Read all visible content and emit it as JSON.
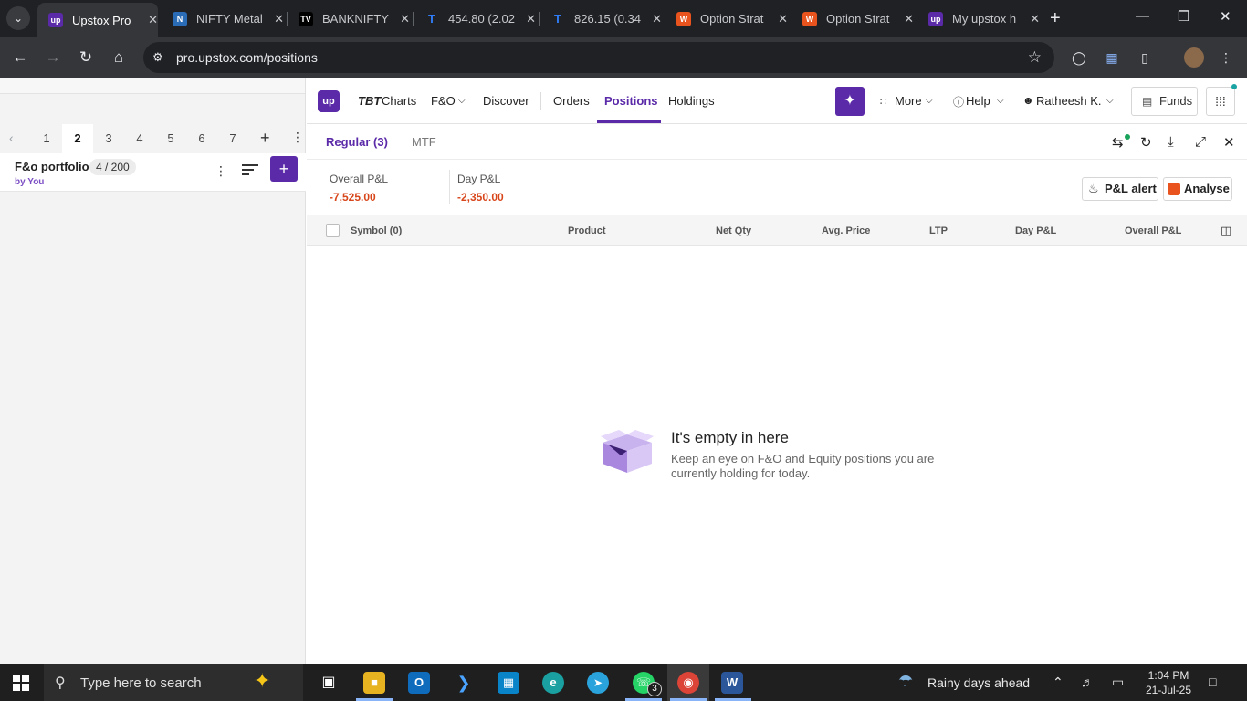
{
  "browser": {
    "tabs": [
      {
        "title": "Upstox Pro",
        "favicon": "upstox-icon",
        "fav_color": "#5a2aa8",
        "fav_text": "up"
      },
      {
        "title": "NIFTY Metal",
        "favicon": "chart-icon",
        "fav_color": "#2a6cb5",
        "fav_text": "N"
      },
      {
        "title": "BANKNIFTY",
        "favicon": "tradingview-icon",
        "fav_color": "#000000",
        "fav_text": "TV"
      },
      {
        "title": "454.80 (2.02",
        "favicon": "tradingview-icon",
        "fav_color": "#202124",
        "fav_text": "T"
      },
      {
        "title": "826.15 (0.34",
        "favicon": "tradingview-icon",
        "fav_color": "#202124",
        "fav_text": "T"
      },
      {
        "title": "Option Strat",
        "favicon": "sensibull-icon",
        "fav_color": "#e8531e",
        "fav_text": "W"
      },
      {
        "title": "Option Strat",
        "favicon": "sensibull-icon",
        "fav_color": "#e8531e",
        "fav_text": "W"
      },
      {
        "title": "My upstox h",
        "favicon": "upstox-icon",
        "fav_color": "#5a2aa8",
        "fav_text": "up"
      }
    ],
    "url": "pro.upstox.com/positions"
  },
  "watchlist": {
    "numbers": [
      "1",
      "2",
      "3",
      "4",
      "5",
      "6",
      "7"
    ],
    "active_index": 1,
    "portfolio_name": "F&o portfolio",
    "portfolio_count": "4 / 200",
    "portfolio_by": "by You"
  },
  "appbar": {
    "logo_text": "up",
    "nav": {
      "charts_prefix": "TBT",
      "charts": "Charts",
      "fno": "F&O",
      "discover": "Discover",
      "orders": "Orders",
      "positions": "Positions",
      "holdings": "Holdings",
      "more": "More",
      "help": "Help",
      "user": "Ratheesh K."
    },
    "funds": "Funds"
  },
  "subtabs": {
    "regular": "Regular (3)",
    "mtf": "MTF"
  },
  "pnl": {
    "overall_label": "Overall P&L",
    "overall_value": "-7,525.00",
    "day_label": "Day P&L",
    "day_value": "-2,350.00",
    "alert_button": "P&L alert",
    "analyse_button": "Analyse"
  },
  "table": {
    "headers": [
      "Symbol (0)",
      "Product",
      "Net Qty",
      "Avg. Price",
      "LTP",
      "Day P&L",
      "Overall P&L"
    ]
  },
  "empty_state": {
    "title": "It's empty in here",
    "subtitle_line1": "Keep an eye on F&O and Equity positions you are",
    "subtitle_line2": "currently holding for today."
  },
  "taskbar": {
    "search_placeholder": "Type here to search",
    "whatsapp_badge": "3",
    "weather": "Rainy days ahead",
    "time": "1:04 PM",
    "date": "21-Jul-25"
  },
  "colors": {
    "brand": "#5a2aa8",
    "loss": "#d8461b"
  }
}
